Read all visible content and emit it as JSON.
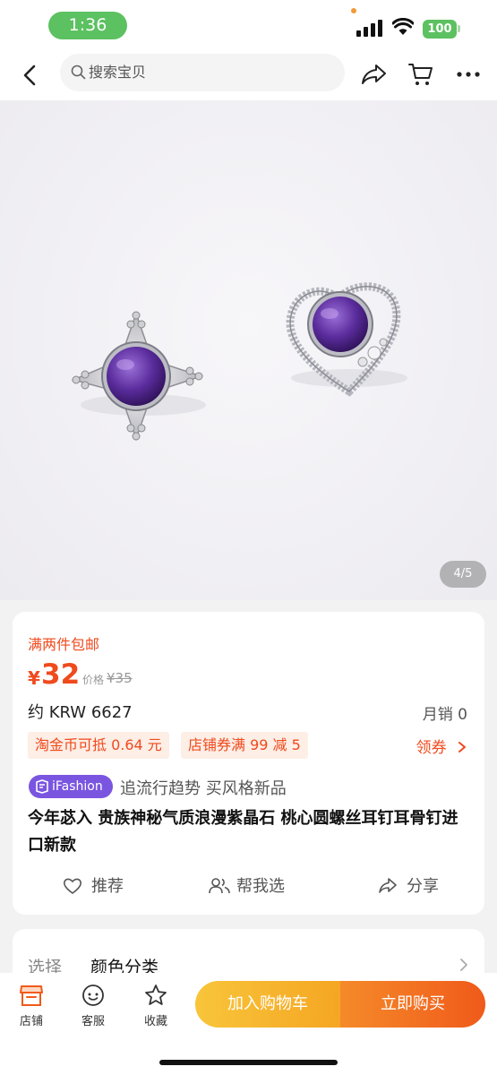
{
  "status_bar": {
    "time": "1:36",
    "battery": "100"
  },
  "header": {
    "search_placeholder": "搜索宝贝"
  },
  "gallery": {
    "counter": "4/5"
  },
  "product": {
    "promo": "满两件包邮",
    "currency": "¥",
    "price": "32",
    "original_label": "价格",
    "original_price": "¥35",
    "converted": "约 KRW 6627",
    "monthly_sales": "月销 0",
    "coupons": [
      "淘金币可抵 0.64 元",
      "店铺券满 99 减 5"
    ],
    "coupon_action": "领券",
    "ifashion_tag": "iFashion",
    "ifashion_slogan": "追流行趋势 买风格新品",
    "title": "今年苾入 贵族神秘气质浪漫紫晶石 桃心圆螺丝耳钉耳骨钉进口新款"
  },
  "actions": {
    "recommend": "推荐",
    "help_choose": "帮我选",
    "share": "分享"
  },
  "options": {
    "label": "选择",
    "value": "颜色分类"
  },
  "bottom_nav": {
    "shop": "店铺",
    "service": "客服",
    "favorite": "收藏",
    "add_to_cart": "加入购物车",
    "buy_now": "立即购买"
  },
  "colors": {
    "accent": "#f04a1d",
    "ifashion": "#7a55e0",
    "cart_button": "#f5a623",
    "buy_button": "#f05a1a"
  }
}
